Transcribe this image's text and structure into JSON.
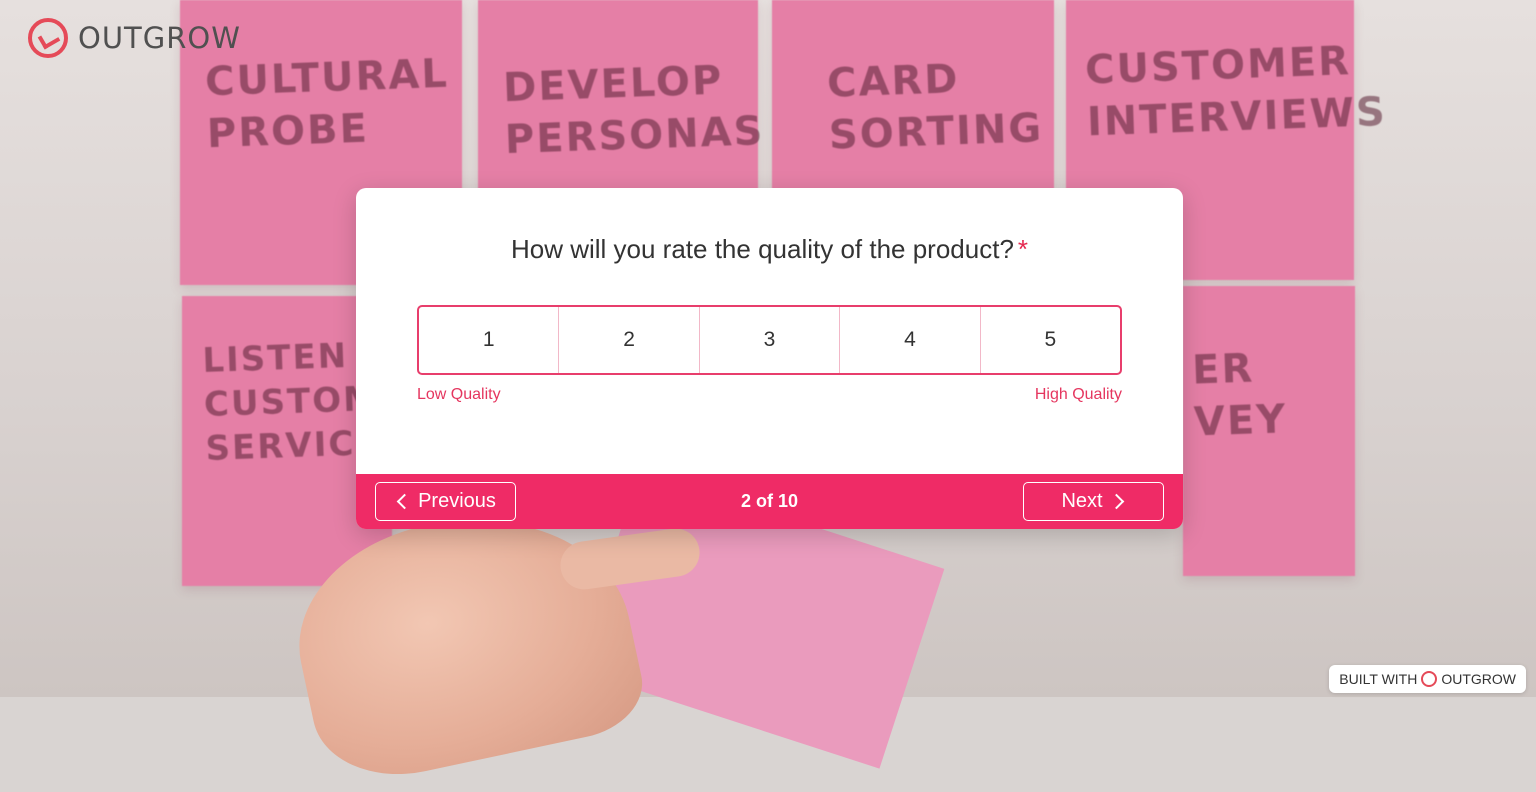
{
  "brand": {
    "name": "OUTGROW",
    "accent": "#ef2b66",
    "logo_color": "#e54a58"
  },
  "background_notes": [
    "CULTURAL\nPROBE",
    "DEVELOP\nPERSONAS",
    "CARD\nSORTING",
    "CUSTOMER\nINTERVIEWS",
    "LISTEN\nCUSTOMER\nSERVICE",
    "ER\nVEY"
  ],
  "question": {
    "text": "How will you rate the quality of the product?",
    "required_mark": "*"
  },
  "scale": {
    "options": [
      "1",
      "2",
      "3",
      "4",
      "5"
    ],
    "low_label": "Low Quality",
    "high_label": "High Quality"
  },
  "footer": {
    "previous_label": "Previous",
    "progress": "2 of 10",
    "next_label": "Next"
  },
  "badge": {
    "prefix": "BUILT WITH",
    "brand": "OUTGROW"
  }
}
